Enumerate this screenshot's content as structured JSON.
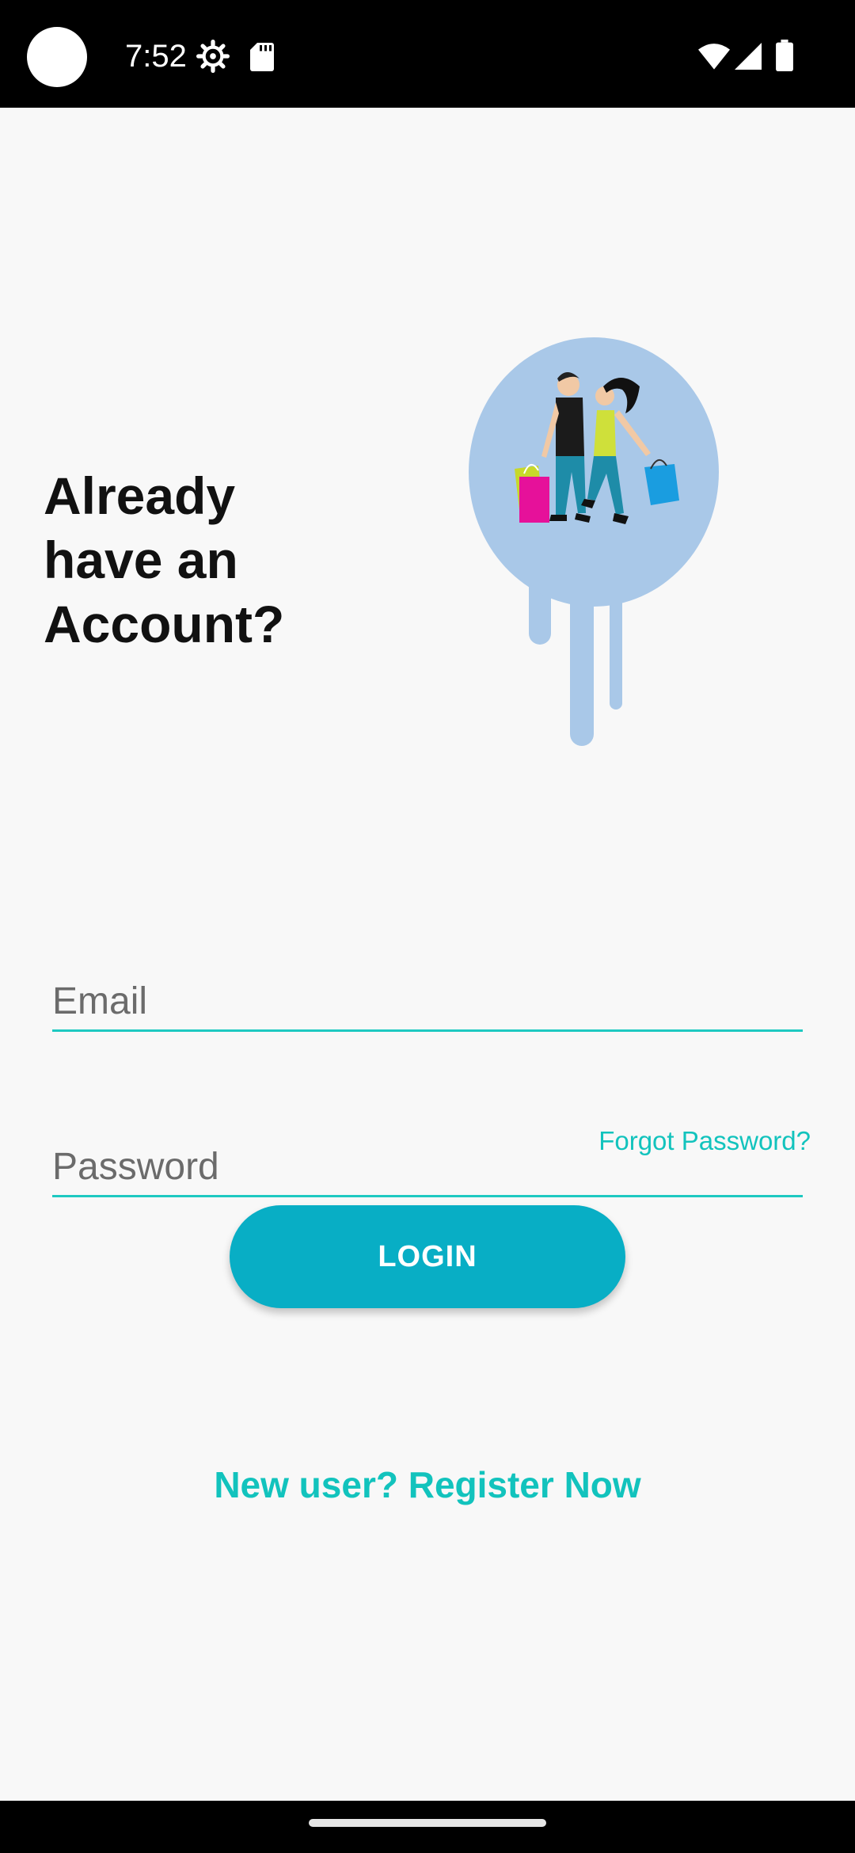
{
  "status_bar": {
    "time": "7:52",
    "icons": [
      "settings-icon",
      "sd-card-icon",
      "wifi-icon",
      "cellular-signal-icon",
      "battery-icon"
    ]
  },
  "login": {
    "heading": "Already have an Account?",
    "hero_image": "shopping-couple-illustration",
    "email_placeholder": "Email",
    "password_placeholder": "Password",
    "forgot_link": "Forgot Password?",
    "login_button": "LOGIN",
    "register_link": "New user? Register Now"
  },
  "colors": {
    "accent": "#12c3bd",
    "button": "#08aec5",
    "background": "#f8f8f8",
    "hero_circle": "#a9c8e8"
  }
}
